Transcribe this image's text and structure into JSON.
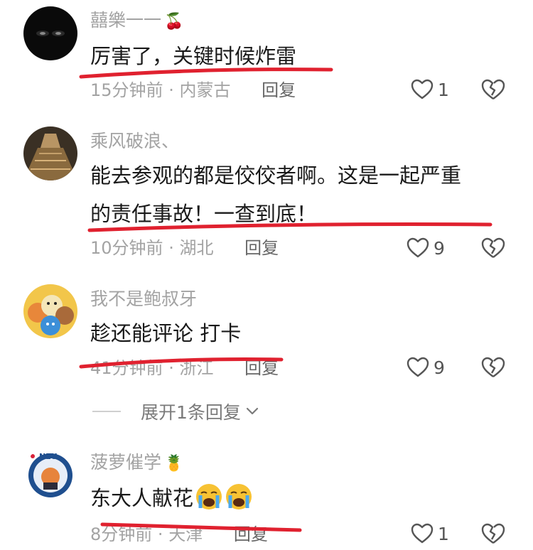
{
  "comments": [
    {
      "username": "囍樂一一",
      "username_emoji": "🍒",
      "text": "厉害了，关键时候炸雷",
      "time": "15分钟前",
      "location": "内蒙古",
      "reply_label": "回复",
      "likes": "1"
    },
    {
      "username": "乘风破浪、",
      "text_line1": "能去参观的都是佼佼者啊。这是一起严重",
      "text_line2": "的责任事故！一查到底！",
      "time": "10分钟前",
      "location": "湖北",
      "reply_label": "回复",
      "likes": "9"
    },
    {
      "username": "我不是鲍叔牙",
      "text": "趁还能评论 打卡",
      "time": "41分钟前",
      "location": "浙江",
      "reply_label": "回复",
      "likes": "9"
    },
    {
      "username": "菠萝催学",
      "username_emoji": "🍍",
      "text": "东大人献花",
      "time": "8分钟前",
      "location": "天津",
      "reply_label": "回复",
      "likes": "1"
    }
  ],
  "expand_replies": "展开1条回复",
  "meta_separator": "·",
  "avatar4_badge_text": "NEU",
  "colors": {
    "underline_red": "#e0212f",
    "muted_text": "#a3a3a3",
    "body_text": "#1a1a1a"
  }
}
